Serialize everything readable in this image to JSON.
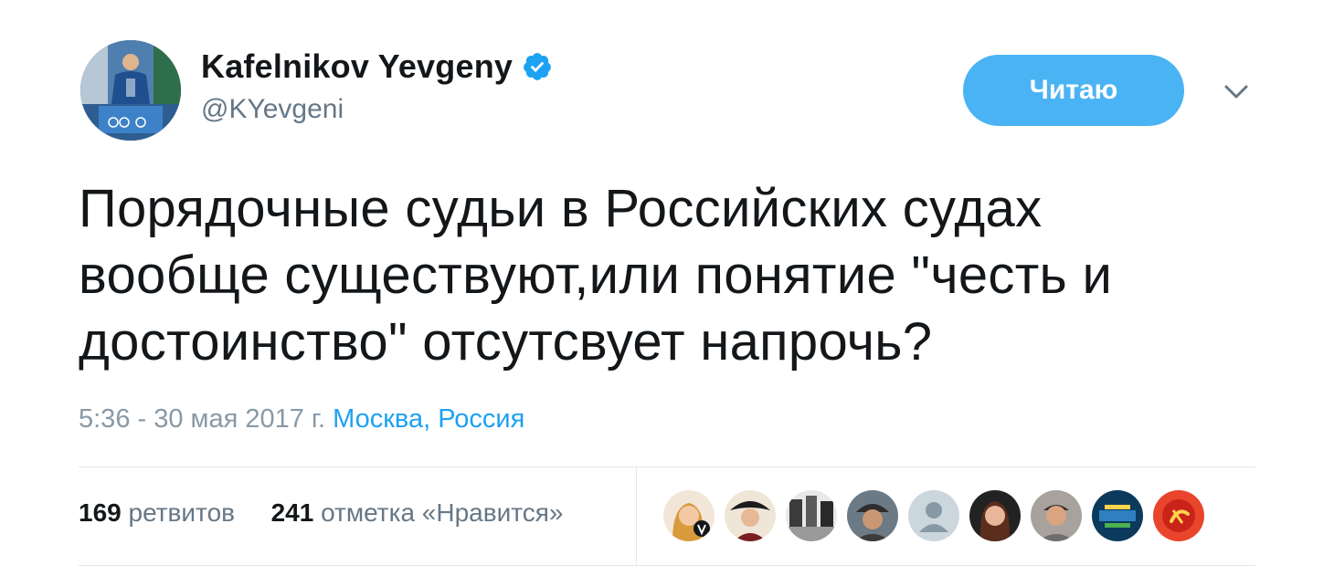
{
  "user": {
    "display_name": "Kafelnikov Yevgeny",
    "handle": "@KYevgeni",
    "verified_icon": "verified-badge-icon",
    "avatar_icon": "user-avatar"
  },
  "follow_button": {
    "label": "Читаю",
    "color": "#4ab3f4"
  },
  "menu": {
    "icon": "chevron-down-icon"
  },
  "tweet": {
    "text": "Порядочные судьи в Российских судах вообще существуют,или понятие \"честь и достоинство\" отсутсвует напрочь?",
    "timestamp": "5:36 - 30 мая 2017 г.",
    "location": "Москва, Россия"
  },
  "stats": {
    "retweets_count": "169",
    "retweets_label": "ретвитов",
    "likes_count": "241",
    "likes_label": "отметка «Нравится»"
  },
  "likers": [
    {
      "icon": "liker-avatar-1"
    },
    {
      "icon": "liker-avatar-2"
    },
    {
      "icon": "liker-avatar-3"
    },
    {
      "icon": "liker-avatar-4"
    },
    {
      "icon": "default-avatar-icon"
    },
    {
      "icon": "liker-avatar-6"
    },
    {
      "icon": "liker-avatar-7"
    },
    {
      "icon": "liker-avatar-8"
    },
    {
      "icon": "liker-avatar-9"
    }
  ],
  "colors": {
    "text": "#14171a",
    "secondary": "#657786",
    "muted": "#8899a6",
    "link": "#1da1f2",
    "divider": "#e1e8ed"
  }
}
